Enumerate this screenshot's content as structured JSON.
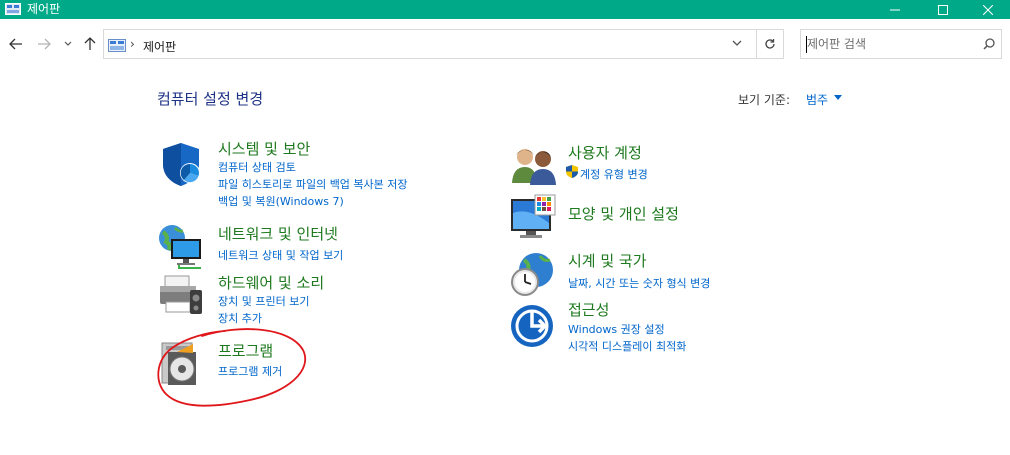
{
  "window": {
    "title": "제어판",
    "controls": [
      "minimize-icon",
      "maximize-icon",
      "close-icon"
    ]
  },
  "address_bar": {
    "path_separator": "›",
    "path": "제어판",
    "search_placeholder": "제어판 검색"
  },
  "main": {
    "heading": "컴퓨터 설정 변경",
    "view_by_label": "보기 기준:",
    "view_by_value": "범주"
  },
  "categories": [
    {
      "title": "시스템 및 보안",
      "icon": "shield-icon",
      "links": [
        "컴퓨터 상태 검토",
        "파일 히스토리로 파일의 백업 복사본 저장",
        "백업 및 복원(Windows 7)"
      ]
    },
    {
      "title": "네트워크 및 인터넷",
      "icon": "network-icon",
      "links": [
        "네트워크 상태 및 작업 보기"
      ]
    },
    {
      "title": "하드웨어 및 소리",
      "icon": "printer-icon",
      "links": [
        "장치 및 프린터 보기",
        "장치 추가"
      ]
    },
    {
      "title": "프로그램",
      "icon": "programs-icon",
      "links": [
        "프로그램 제거"
      ]
    },
    {
      "title": "사용자 계정",
      "icon": "users-icon",
      "links": [
        "계정 유형 변경"
      ]
    },
    {
      "title": "모양 및 개인 설정",
      "icon": "personalization-icon",
      "links": []
    },
    {
      "title": "시계 및 국가",
      "icon": "clock-icon",
      "links": [
        "날짜, 시간 또는 숫자 형식 변경"
      ]
    },
    {
      "title": "접근성",
      "icon": "accessibility-icon",
      "links": [
        "Windows 권장 설정",
        "시각적 디스플레이 최적화"
      ]
    }
  ],
  "annotation": {
    "color": "#e0161b",
    "target": "프로그램"
  },
  "colors": {
    "titlebar": "#00a987",
    "heading": "#1e3287",
    "category_title": "#1e7a1e",
    "link": "#0066cc"
  }
}
